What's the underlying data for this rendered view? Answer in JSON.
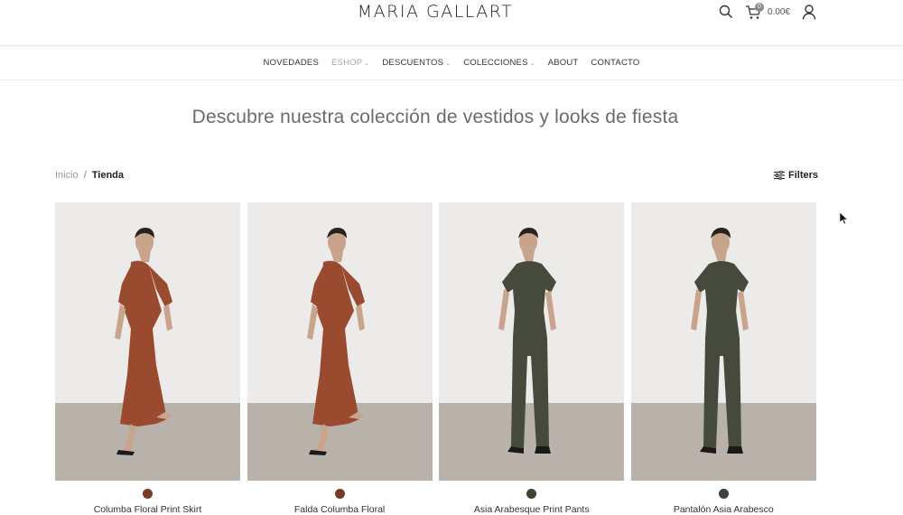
{
  "header": {
    "logo": "MARIA GALLART",
    "cart_count": "0",
    "cart_total": "0.00€",
    "icons": [
      "search-icon",
      "cart-icon",
      "user-icon"
    ]
  },
  "nav": {
    "items": [
      {
        "label": "NOVEDADES",
        "dropdown": false,
        "active": false
      },
      {
        "label": "ESHOP",
        "dropdown": true,
        "active": true
      },
      {
        "label": "DESCUENTOS",
        "dropdown": true,
        "active": false
      },
      {
        "label": "COLECCIONES",
        "dropdown": true,
        "active": false
      },
      {
        "label": "ABOUT",
        "dropdown": false,
        "active": false
      },
      {
        "label": "CONTACTO",
        "dropdown": false,
        "active": false
      }
    ]
  },
  "hero": {
    "title": "Descubre nuestra colección de vestidos y looks de fiesta"
  },
  "breadcrumb": {
    "home": "Inicio",
    "separator": "/",
    "current": "Tienda"
  },
  "filters": {
    "label": "Filters",
    "icon": "sliders-icon"
  },
  "products": [
    {
      "name": "Columba Floral Print Skirt",
      "swatch": "#7a3b26",
      "garment": "#9a4a2e",
      "pose": "dress"
    },
    {
      "name": "Falda Columba Floral",
      "swatch": "#7a3b26",
      "garment": "#9a4a2e",
      "pose": "dress"
    },
    {
      "name": "Asia Arabesque Print Pants",
      "swatch": "#3f4236",
      "garment": "#454a3c",
      "pose": "jumpsuit"
    },
    {
      "name": "Pantalón Asia Arabesco",
      "swatch": "#3f4236",
      "garment": "#454a3c",
      "pose": "jumpsuit"
    }
  ],
  "colors": {
    "wall": "#ecebea",
    "floor": "#b9b2aa",
    "skin": "#c9a48c",
    "hair": "#2a211d"
  }
}
